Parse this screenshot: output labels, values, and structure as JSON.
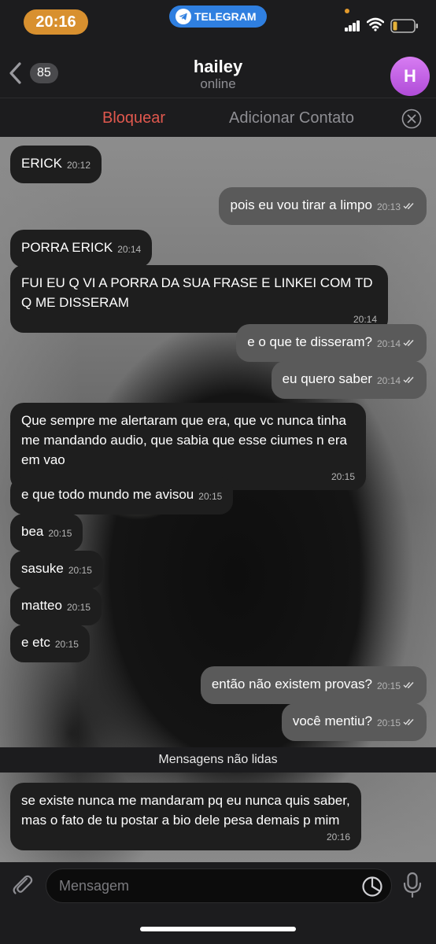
{
  "status_bar": {
    "time": "20:16",
    "app_label": "TELEGRAM"
  },
  "header": {
    "back_count": "85",
    "title": "hailey",
    "status": "online",
    "avatar_initial": "H"
  },
  "actions": {
    "block": "Bloquear",
    "add_contact": "Adicionar Contato"
  },
  "messages": [
    {
      "dir": "in",
      "text": "ERICK",
      "time": "20:12"
    },
    {
      "dir": "out",
      "text": "pois eu vou tirar a limpo",
      "time": "20:13"
    },
    {
      "dir": "in",
      "text": "PORRA ERICK",
      "time": "20:14"
    },
    {
      "dir": "in",
      "text": "FUI EU Q VI A PORRA DA SUA FRASE E LINKEI COM TD Q ME DISSERAM",
      "time": "20:14"
    },
    {
      "dir": "out",
      "text": "e o que te disseram?",
      "time": "20:14"
    },
    {
      "dir": "out",
      "text": "eu quero saber",
      "time": "20:14"
    },
    {
      "dir": "in",
      "text": "Que sempre me alertaram que era, que vc nunca tinha me mandando audio, que sabia que esse ciumes n era em vao",
      "time": "20:15"
    },
    {
      "dir": "in",
      "text": "e que todo mundo me avisou",
      "time": "20:15"
    },
    {
      "dir": "in",
      "text": "bea",
      "time": "20:15"
    },
    {
      "dir": "in",
      "text": "sasuke",
      "time": "20:15"
    },
    {
      "dir": "in",
      "text": "matteo",
      "time": "20:15"
    },
    {
      "dir": "in",
      "text": "e etc",
      "time": "20:15"
    },
    {
      "dir": "out",
      "text": "então não existem provas?",
      "time": "20:15"
    },
    {
      "dir": "out",
      "text": "você mentiu?",
      "time": "20:15"
    },
    {
      "dir": "in",
      "text": "se existe nunca me mandaram pq eu nunca quis saber, mas o fato de tu postar a bio dele pesa demais p mim",
      "time": "20:16"
    }
  ],
  "unread_divider": "Mensagens não lidas",
  "input": {
    "placeholder": "Mensagem"
  },
  "colors": {
    "block_red": "#e0584e",
    "telegram_blue": "#2f7fe0",
    "time_pill": "#d8902f",
    "avatar_purple": "#c465e6"
  }
}
